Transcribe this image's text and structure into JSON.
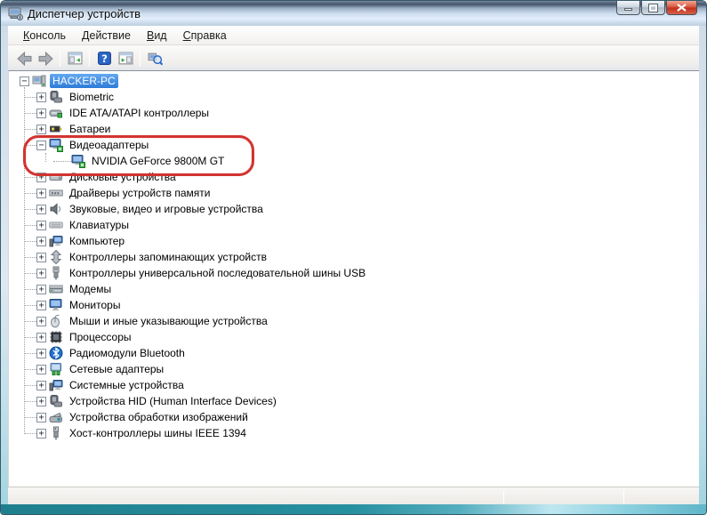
{
  "window": {
    "title": "Диспетчер устройств",
    "controls": [
      {
        "name": "minimize-button"
      },
      {
        "name": "maximize-button"
      },
      {
        "name": "close-button"
      }
    ]
  },
  "menu": {
    "items": [
      {
        "label": "Консоль"
      },
      {
        "label": "Действие"
      },
      {
        "label": "Вид"
      },
      {
        "label": "Справка"
      }
    ]
  },
  "toolbar": {
    "groups": [
      [
        "back-icon",
        "forward-icon"
      ],
      [
        "show-console-tree-icon"
      ],
      [
        "help-icon",
        "show-action-pane-icon"
      ],
      [
        "scan-hardware-changes-icon"
      ]
    ]
  },
  "tree": {
    "items": [
      {
        "label": "HACKER-PC",
        "level": 0,
        "expander": "minus",
        "icon": "computer-icon",
        "selected": true
      },
      {
        "label": "Biometric",
        "level": 1,
        "expander": "plus",
        "icon": "biometric-icon"
      },
      {
        "label": "IDE ATA/ATAPI контроллеры",
        "level": 1,
        "expander": "plus",
        "icon": "ide-controller-icon"
      },
      {
        "label": "Батареи",
        "level": 1,
        "expander": "plus",
        "icon": "battery-icon"
      },
      {
        "label": "Видеоадаптеры",
        "level": 1,
        "expander": "minus",
        "icon": "video-adapter-icon",
        "annotated": true
      },
      {
        "label": "NVIDIA GeForce 9800M GT",
        "level": 2,
        "expander": "none",
        "icon": "video-adapter-icon",
        "annotated": true
      },
      {
        "label": "Дисковые устройства",
        "level": 1,
        "expander": "plus",
        "icon": "disk-drive-icon"
      },
      {
        "label": "Драйверы устройств памяти",
        "level": 1,
        "expander": "plus",
        "icon": "memory-driver-icon"
      },
      {
        "label": "Звуковые, видео и игровые устройства",
        "level": 1,
        "expander": "plus",
        "icon": "audio-icon"
      },
      {
        "label": "Клавиатуры",
        "level": 1,
        "expander": "plus",
        "icon": "keyboard-icon"
      },
      {
        "label": "Компьютер",
        "level": 1,
        "expander": "plus",
        "icon": "system-icon"
      },
      {
        "label": "Контроллеры запоминающих устройств",
        "level": 1,
        "expander": "plus",
        "icon": "storage-controller-icon"
      },
      {
        "label": "Контроллеры универсальной последовательной шины USB",
        "level": 1,
        "expander": "plus",
        "icon": "usb-icon"
      },
      {
        "label": "Модемы",
        "level": 1,
        "expander": "plus",
        "icon": "modem-icon"
      },
      {
        "label": "Мониторы",
        "level": 1,
        "expander": "plus",
        "icon": "monitor-icon"
      },
      {
        "label": "Мыши и иные указывающие устройства",
        "level": 1,
        "expander": "plus",
        "icon": "mouse-icon"
      },
      {
        "label": "Процессоры",
        "level": 1,
        "expander": "plus",
        "icon": "cpu-icon"
      },
      {
        "label": "Радиомодули Bluetooth",
        "level": 1,
        "expander": "plus",
        "icon": "bluetooth-icon"
      },
      {
        "label": "Сетевые адаптеры",
        "level": 1,
        "expander": "plus",
        "icon": "network-icon"
      },
      {
        "label": "Системные устройства",
        "level": 1,
        "expander": "plus",
        "icon": "system-icon"
      },
      {
        "label": "Устройства HID (Human Interface Devices)",
        "level": 1,
        "expander": "plus",
        "icon": "biometric-icon"
      },
      {
        "label": "Устройства обработки изображений",
        "level": 1,
        "expander": "plus",
        "icon": "imaging-icon"
      },
      {
        "label": "Хост-контроллеры шины IEEE 1394",
        "level": 1,
        "expander": "plus",
        "icon": "ieee1394-icon"
      }
    ]
  },
  "annotation": {
    "shape": "red-rounded-rectangle",
    "color": "#d23430",
    "marks": [
      "Видеоадаптеры",
      "NVIDIA GeForce 9800M GT"
    ]
  },
  "colors": {
    "selection": "#2d7bd8",
    "annotation": "#d23430",
    "window_frame_bottom": "#27909f"
  }
}
